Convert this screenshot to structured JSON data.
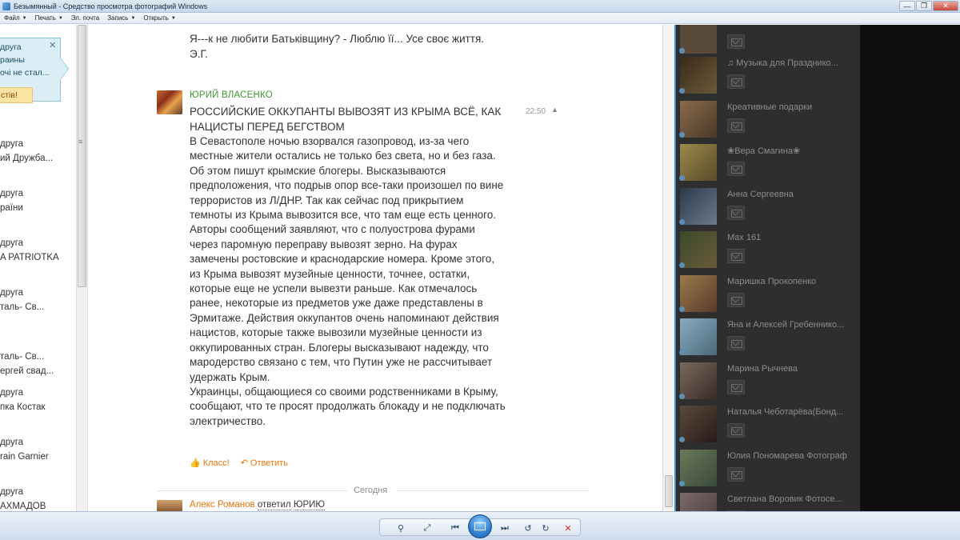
{
  "window": {
    "title": "Безымянный - Средство просмотра фотографий Windows",
    "minimize": "—",
    "maximize": "❐",
    "close": "✕"
  },
  "menu": [
    {
      "label": "Файл"
    },
    {
      "label": "Печать"
    },
    {
      "label": "Эл. почта"
    },
    {
      "label": "Запись"
    },
    {
      "label": "Открыть"
    }
  ],
  "left_panel": {
    "callout_lines": [
      "друга",
      "раины",
      "очі не стал..."
    ],
    "callout_close": "✕",
    "orange_button": "стів!",
    "friends": [
      {
        "line1": "друга",
        "line2": "ий Дружба..."
      },
      {
        "line1": "друга",
        "line2": "раїни"
      },
      {
        "line1": "друга",
        "line2": "A PATRIOTKA"
      },
      {
        "line1": "друга",
        "line2": "таль- Св..."
      },
      {
        "line1": "таль- Св...",
        "line2": "ергей свад..."
      },
      {
        "line1": "друга",
        "line2": "пка Костак"
      },
      {
        "line1": "друга",
        "line2": "rain Garnier"
      },
      {
        "line1": "друга",
        "line2": "АХМАДОВ"
      }
    ]
  },
  "prev_post": {
    "lines": [
      "Я---к не любити Батьківщину? - Люблю її... Усе своє життя.",
      "Э.Г."
    ]
  },
  "post": {
    "author": "ЮРИЙ ВЛАСЕНКО",
    "title": "РОССИЙСКИЕ ОККУПАНТЫ ВЫВОЗЯТ ИЗ КРЫМА ВСЁ, КАК НАЦИСТЫ ПЕРЕД БЕГСТВОМ",
    "time": "22:50",
    "time_icon": "▲",
    "paragraphs": [
      "В Севастополе ночью взорвался газопровод, из-за чего местные жители остались не только без света, но и без газа.",
      "Об этом пишут крымские блогеры. Высказываются предположения, что подрыв опор все-таки произошел по вине террористов из Л/ДНР. Так как сейчас под прикрытием темноты из Крыма вывозится все, что там еще есть ценного. Авторы сообщений заявляют, что с полуострова фурами через паромную переправу вывозят зерно. На фурах замечены ростовские и краснодарские номера. Кроме этого, из Крыма вывозят музейные ценности, точнее, остатки, которые еще не успели вывезти раньше. Как отмечалось ранее, некоторые из предметов уже даже представлены в Эрмитаже. Действия оккупантов очень напоминают действия нацистов, которые также вывозили музейные ценности из оккупированных стран. Блогеры высказывают надежду, что мародерство связано с тем, что Путин уже не рассчитывает удержать Крым.",
      "Украинцы, общающиеся со своими родственниками в Крыму, сообщают, что те просят продолжать блокаду и не подключать электричество."
    ],
    "like_label": "Класс!",
    "reply_label": "Ответить"
  },
  "divider_label": "Сегодня",
  "reply": {
    "author": "Алекс Романов",
    "action": "ответил",
    "target": "ЮРИЮ"
  },
  "right_panel": {
    "items": [
      {
        "name": "",
        "color": "#5a4a3a"
      },
      {
        "name": "♫ Музыка для Празднико...",
        "color": "#4a3a2a"
      },
      {
        "name": "Креативные подарки",
        "color": "#6b5a44"
      },
      {
        "name": "❀Вера Смагина❀",
        "color": "#7a6a3a"
      },
      {
        "name": "Анна Сергеевна",
        "color": "#3a4a5a"
      },
      {
        "name": "Max 161",
        "color": "#4a5a3a"
      },
      {
        "name": "Маришка Прокопенко",
        "color": "#7a5a3a"
      },
      {
        "name": "Яна и Алексей Гребеннико...",
        "color": "#5a7a8a"
      },
      {
        "name": "Марина Рычнева",
        "color": "#6a5a4a"
      },
      {
        "name": "Наталья Чеботарёва(Бонд...",
        "color": "#4a3a2a"
      },
      {
        "name": "Юлия Пономарева Фотограф",
        "color": "#5a6a4a"
      },
      {
        "name": "Светлана Воровик Фотосе...",
        "color": "#6a5a5a"
      }
    ]
  },
  "toolbar": {
    "zoom_icon": "⚲",
    "fit_icon": "⤢",
    "prev_icon": "⏮",
    "next_icon": "⏭",
    "rotate_ccw_icon": "↺",
    "rotate_cw_icon": "↻",
    "delete_icon": "✕"
  }
}
